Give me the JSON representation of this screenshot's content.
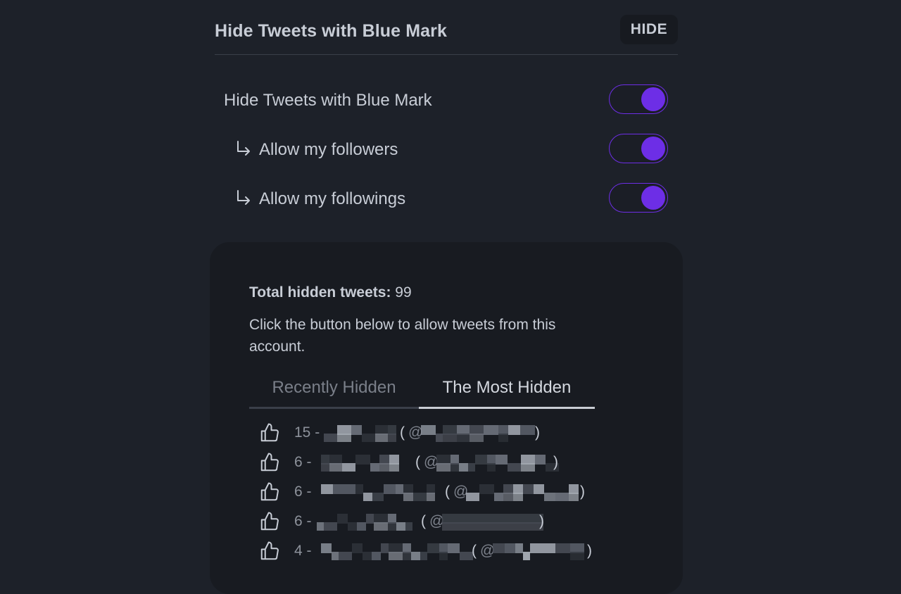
{
  "header": {
    "title": "Hide Tweets with Blue Mark",
    "hide_button": "HIDE"
  },
  "settings": [
    {
      "label": "Hide Tweets with Blue Mark",
      "enabled": true,
      "accent": "#6d2ee6"
    },
    {
      "label": "Allow my followers",
      "enabled": true,
      "accent": "#6d2ee6"
    },
    {
      "label": "Allow my followings",
      "enabled": true,
      "accent": "#6d2ee6"
    }
  ],
  "panel": {
    "total_label": "Total hidden tweets:",
    "total_value": "99",
    "description": "Click the button below to allow tweets from this account.",
    "tabs": [
      {
        "label": "Recently Hidden",
        "active": false
      },
      {
        "label": "The Most Hidden",
        "active": true
      }
    ],
    "hidden_accounts": [
      {
        "count": "15 -",
        "open": "(",
        "at": "@",
        "close": ")"
      },
      {
        "count": "6 -",
        "open": "(",
        "at": "@",
        "close": ")"
      },
      {
        "count": "6 -",
        "open": "(",
        "at": "@",
        "close": ")"
      },
      {
        "count": "6 -",
        "open": "(",
        "at": "@",
        "close": ")"
      },
      {
        "count": "4 -",
        "open": "(",
        "at": "@",
        "close": ")"
      }
    ]
  },
  "icons": {
    "sub_setting": "arrow-turn-down-right-icon",
    "allow_action": "thumbs-up-icon"
  },
  "colors": {
    "background": "#1d2129",
    "panel": "#181b21",
    "accent": "#6d2ee6",
    "text": "#c8cdd6"
  }
}
